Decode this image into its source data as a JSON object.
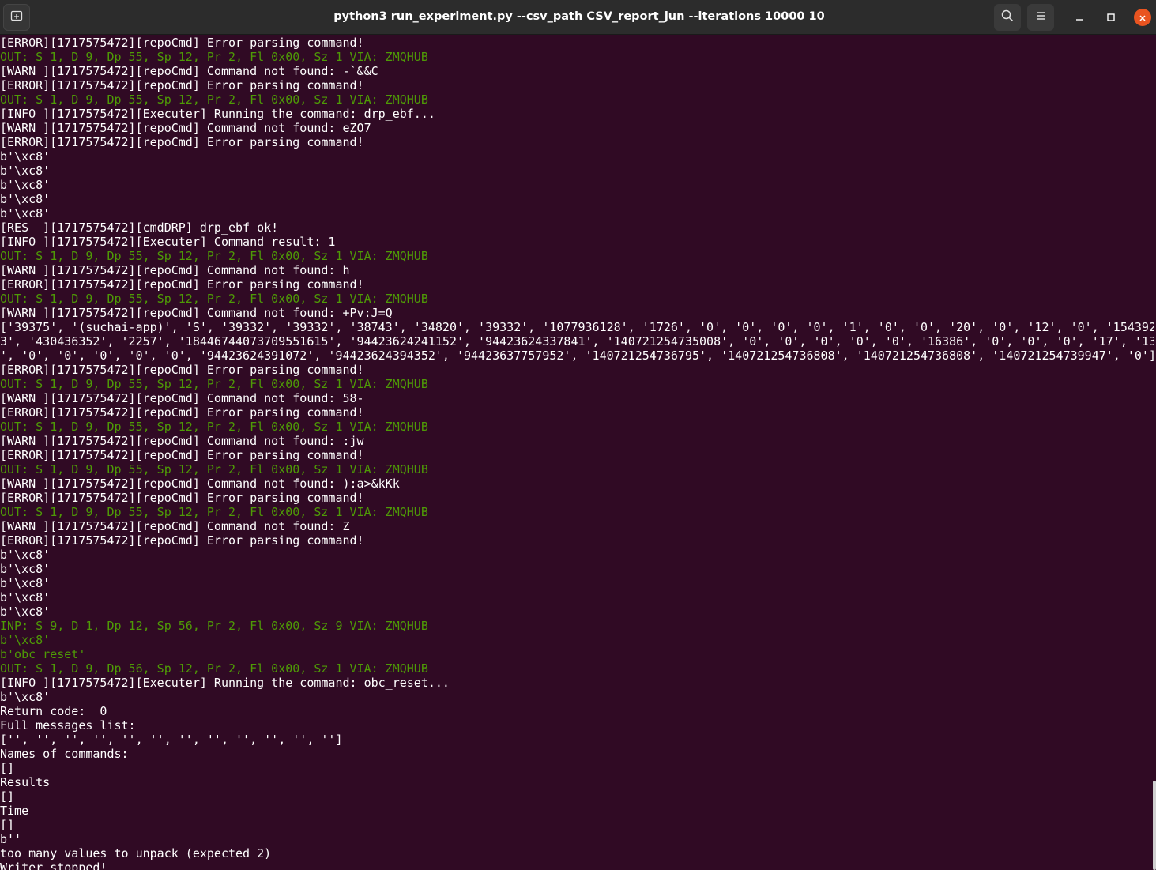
{
  "window": {
    "title": "python3 run_experiment.py --csv_path CSV_report_jun --iterations 10000  10",
    "background": "#300a24",
    "titlebar_color": "#2c2c2c",
    "close_color": "#e95420"
  },
  "icons": {
    "new_tab": "new-tab-icon",
    "search": "search-icon",
    "menu": "hamburger-menu-icon",
    "minimize": "minimize-icon",
    "maximize": "maximize-icon",
    "close": "close-icon"
  },
  "terminal": {
    "colors": {
      "default": "#ffffff",
      "green": "#4e9a06"
    },
    "lines": [
      {
        "text": "[ERROR][1717575472][repoCmd] Error parsing command!",
        "color": "default"
      },
      {
        "text": "OUT: S 1, D 9, Dp 55, Sp 12, Pr 2, Fl 0x00, Sz 1 VIA: ZMQHUB",
        "color": "green"
      },
      {
        "text": "[WARN ][1717575472][repoCmd] Command not found: -`&&C",
        "color": "default"
      },
      {
        "text": "[ERROR][1717575472][repoCmd] Error parsing command!",
        "color": "default"
      },
      {
        "text": "OUT: S 1, D 9, Dp 55, Sp 12, Pr 2, Fl 0x00, Sz 1 VIA: ZMQHUB",
        "color": "green"
      },
      {
        "text": "[INFO ][1717575472][Executer] Running the command: drp_ebf...",
        "color": "default"
      },
      {
        "text": "[WARN ][1717575472][repoCmd] Command not found: eZO7",
        "color": "default"
      },
      {
        "text": "[ERROR][1717575472][repoCmd] Error parsing command!",
        "color": "default"
      },
      {
        "text": "b'\\xc8'",
        "color": "default"
      },
      {
        "text": "b'\\xc8'",
        "color": "default"
      },
      {
        "text": "b'\\xc8'",
        "color": "default"
      },
      {
        "text": "b'\\xc8'",
        "color": "default"
      },
      {
        "text": "b'\\xc8'",
        "color": "default"
      },
      {
        "text": "[RES  ][1717575472][cmdDRP] drp_ebf ok!",
        "color": "default"
      },
      {
        "text": "[INFO ][1717575472][Executer] Command result: 1",
        "color": "default"
      },
      {
        "text": "OUT: S 1, D 9, Dp 55, Sp 12, Pr 2, Fl 0x00, Sz 1 VIA: ZMQHUB",
        "color": "green"
      },
      {
        "text": "[WARN ][1717575472][repoCmd] Command not found: h",
        "color": "default"
      },
      {
        "text": "[ERROR][1717575472][repoCmd] Error parsing command!",
        "color": "default"
      },
      {
        "text": "OUT: S 1, D 9, Dp 55, Sp 12, Pr 2, Fl 0x00, Sz 1 VIA: ZMQHUB",
        "color": "green"
      },
      {
        "text": "[WARN ][1717575472][repoCmd] Command not found: +Pv:J=Q",
        "color": "default"
      },
      {
        "text": "['39375', '(suchai-app)', 'S', '39332', '39332', '38743', '34820', '39332', '1077936128', '1726', '0', '0', '0', '0', '1', '0', '0', '20', '0', '12', '0', '154392",
        "color": "default"
      },
      {
        "text": "3', '430436352', '2257', '18446744073709551615', '94423624241152', '94423624337841', '140721254735008', '0', '0', '0', '0', '0', '16386', '0', '0', '0', '17', '13",
        "color": "default"
      },
      {
        "text": "', '0', '0', '0', '0', '0', '94423624391072', '94423624394352', '94423637757952', '140721254736795', '140721254736808', '140721254736808', '140721254739947', '0']",
        "color": "default"
      },
      {
        "text": "[ERROR][1717575472][repoCmd] Error parsing command!",
        "color": "default"
      },
      {
        "text": "OUT: S 1, D 9, Dp 55, Sp 12, Pr 2, Fl 0x00, Sz 1 VIA: ZMQHUB",
        "color": "green"
      },
      {
        "text": "[WARN ][1717575472][repoCmd] Command not found: 58-",
        "color": "default"
      },
      {
        "text": "[ERROR][1717575472][repoCmd] Error parsing command!",
        "color": "default"
      },
      {
        "text": "OUT: S 1, D 9, Dp 55, Sp 12, Pr 2, Fl 0x00, Sz 1 VIA: ZMQHUB",
        "color": "green"
      },
      {
        "text": "[WARN ][1717575472][repoCmd] Command not found: :jw",
        "color": "default"
      },
      {
        "text": "[ERROR][1717575472][repoCmd] Error parsing command!",
        "color": "default"
      },
      {
        "text": "OUT: S 1, D 9, Dp 55, Sp 12, Pr 2, Fl 0x00, Sz 1 VIA: ZMQHUB",
        "color": "green"
      },
      {
        "text": "[WARN ][1717575472][repoCmd] Command not found: ):a>&kKk",
        "color": "default"
      },
      {
        "text": "[ERROR][1717575472][repoCmd] Error parsing command!",
        "color": "default"
      },
      {
        "text": "OUT: S 1, D 9, Dp 55, Sp 12, Pr 2, Fl 0x00, Sz 1 VIA: ZMQHUB",
        "color": "green"
      },
      {
        "text": "[WARN ][1717575472][repoCmd] Command not found: Z",
        "color": "default"
      },
      {
        "text": "[ERROR][1717575472][repoCmd] Error parsing command!",
        "color": "default"
      },
      {
        "text": "b'\\xc8'",
        "color": "default"
      },
      {
        "text": "b'\\xc8'",
        "color": "default"
      },
      {
        "text": "b'\\xc8'",
        "color": "default"
      },
      {
        "text": "b'\\xc8'",
        "color": "default"
      },
      {
        "text": "b'\\xc8'",
        "color": "default"
      },
      {
        "text": "INP: S 9, D 1, Dp 12, Sp 56, Pr 2, Fl 0x00, Sz 9 VIA: ZMQHUB",
        "color": "green"
      },
      {
        "text": "b'\\xc8'",
        "color": "green"
      },
      {
        "text": "b'obc_reset'",
        "color": "green"
      },
      {
        "text": "OUT: S 1, D 9, Dp 56, Sp 12, Pr 2, Fl 0x00, Sz 1 VIA: ZMQHUB",
        "color": "green"
      },
      {
        "text": "[INFO ][1717575472][Executer] Running the command: obc_reset...",
        "color": "default"
      },
      {
        "text": "b'\\xc8'",
        "color": "default"
      },
      {
        "text": "Return code:  0",
        "color": "default"
      },
      {
        "text": "Full messages list:",
        "color": "default"
      },
      {
        "text": "['', '', '', '', '', '', '', '', '', '', '', '']",
        "color": "default"
      },
      {
        "text": "Names of commands:",
        "color": "default"
      },
      {
        "text": "[]",
        "color": "default"
      },
      {
        "text": "Results",
        "color": "default"
      },
      {
        "text": "[]",
        "color": "default"
      },
      {
        "text": "Time",
        "color": "default"
      },
      {
        "text": "[]",
        "color": "default"
      },
      {
        "text": "b''",
        "color": "default"
      },
      {
        "text": "too many values to unpack (expected 2)",
        "color": "default"
      },
      {
        "text": "Writer stopped!",
        "color": "default"
      }
    ]
  }
}
